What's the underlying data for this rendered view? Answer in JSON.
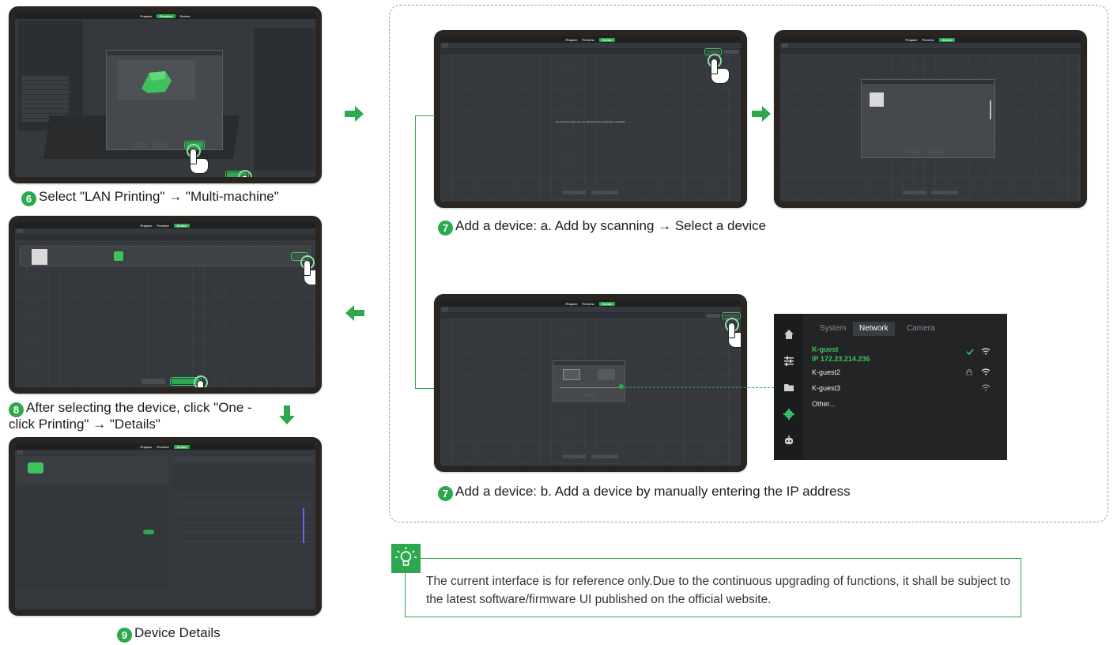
{
  "colors": {
    "accent": "#2ea84e",
    "highlight": "#35c95a",
    "tablet_frame": "#2a2521",
    "screen": "#35383c"
  },
  "app_topbar": {
    "prepare": "Prepare",
    "preview": "Preview",
    "device": "Device"
  },
  "steps": {
    "step6": {
      "number": "6",
      "text": "Select \"LAN Printing\" → \"Multi-machine\""
    },
    "step7a": {
      "number": "7",
      "text": "Add a device: a. Add by scanning → Select a device"
    },
    "step7b": {
      "number": "7",
      "text": "Add a device: b. Add a device by manually entering the IP address"
    },
    "step8": {
      "number": "8",
      "text": "After selecting the device, click \"One -click Printing\" → \"Details\""
    },
    "step9": {
      "number": "9",
      "text": "Device Details"
    }
  },
  "screen7a_left": {
    "empty_message": "Device list is empty, you can add devices by scanning or manually."
  },
  "network_panel": {
    "tabs": [
      "System",
      "Network",
      "Camera"
    ],
    "active_tab": "Network",
    "networks": [
      {
        "name": "K-guest",
        "ip": "IP  172.23.214.236",
        "connected": true,
        "locked": false
      },
      {
        "name": "K-guest2",
        "connected": false,
        "locked": true
      },
      {
        "name": "K-guest3",
        "connected": false,
        "locked": false
      },
      {
        "name": "Other...",
        "connected": false,
        "locked": false
      }
    ],
    "side_icons": [
      "home-icon",
      "sliders-icon",
      "folder-icon",
      "gear-icon",
      "robot-icon"
    ]
  },
  "tip": {
    "icon": "lightbulb-icon",
    "text": "The current interface is for reference only.Due to the continuous upgrading of functions, it shall be subject to the latest software/firmware UI published on the official website."
  }
}
